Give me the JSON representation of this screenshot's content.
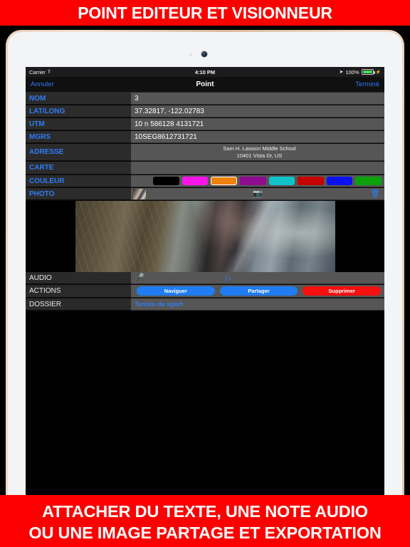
{
  "promo": {
    "top_banner": "POINT EDITEUR ET VISIONNEUR",
    "bottom_line1": "ATTACHER DU TEXTE, UNE NOTE AUDIO",
    "bottom_line2": "OU UNE IMAGE PARTAGE ET EXPORTATION"
  },
  "status_bar": {
    "carrier": "Carrier",
    "wifi_icon": "wifi-icon",
    "time": "4:10 PM",
    "location_icon": "location-arrow-icon",
    "battery_percent": "100%",
    "battery_icon": "battery-full-icon",
    "charging_icon": "lightning-bolt-icon"
  },
  "nav_bar": {
    "cancel_label": "Annuler",
    "title": "Point",
    "done_label": "Terminé"
  },
  "fields": {
    "nom": {
      "label": "NOM",
      "value": "3"
    },
    "latlong": {
      "label": "LAT/LONG",
      "value": "37.32817, -122.02783"
    },
    "utm": {
      "label": "UTM",
      "value": "10 n 586128 4131721"
    },
    "mgrs": {
      "label": "MGRS",
      "value": "10SEG8612731721"
    },
    "adresse": {
      "label": "ADRESSE",
      "line1": "Sam H. Lawson Middle School",
      "line2": "10401 Vista Dr, US"
    },
    "carte": {
      "label": "CARTE",
      "value": ""
    },
    "couleur": {
      "label": "COULEUR",
      "selected_index": 2,
      "swatches": [
        {
          "name": "black",
          "hex": "#000000"
        },
        {
          "name": "magenta",
          "hex": "#f914e8"
        },
        {
          "name": "orange",
          "hex": "#f08008"
        },
        {
          "name": "purple",
          "hex": "#8f0b8f"
        },
        {
          "name": "cyan",
          "hex": "#0fc3c9"
        },
        {
          "name": "red",
          "hex": "#c60000"
        },
        {
          "name": "blue",
          "hex": "#0a12ef"
        },
        {
          "name": "green",
          "hex": "#0aa30a"
        }
      ]
    },
    "photo": {
      "label": "PHOTO",
      "thumbnail_name": "photo-thumbnail",
      "camera_icon": "camera-icon",
      "delete_icon": "trash-icon"
    },
    "audio": {
      "label": "AUDIO",
      "record_icon": "microphone-icon",
      "play_icon": "play-triangle-icon"
    },
    "actions": {
      "label": "ACTIONS",
      "buttons": [
        {
          "name": "navigate",
          "label": "Naviguer",
          "color": "#1f7cf2"
        },
        {
          "name": "share",
          "label": "Partager",
          "color": "#1f7cf2"
        },
        {
          "name": "delete",
          "label": "Supprimer",
          "color": "#f50f0f"
        }
      ]
    },
    "dossier": {
      "label": "DOSSIER",
      "value": "Terrain de sport"
    }
  },
  "viewer": {
    "image_name": "attached-photo-preview"
  },
  "colors": {
    "banner_red": "#fc0000",
    "accent_blue": "#2f7bf6",
    "label_bg": "#2b2b2b",
    "value_bg": "#565656",
    "screen_bg": "#000000"
  }
}
